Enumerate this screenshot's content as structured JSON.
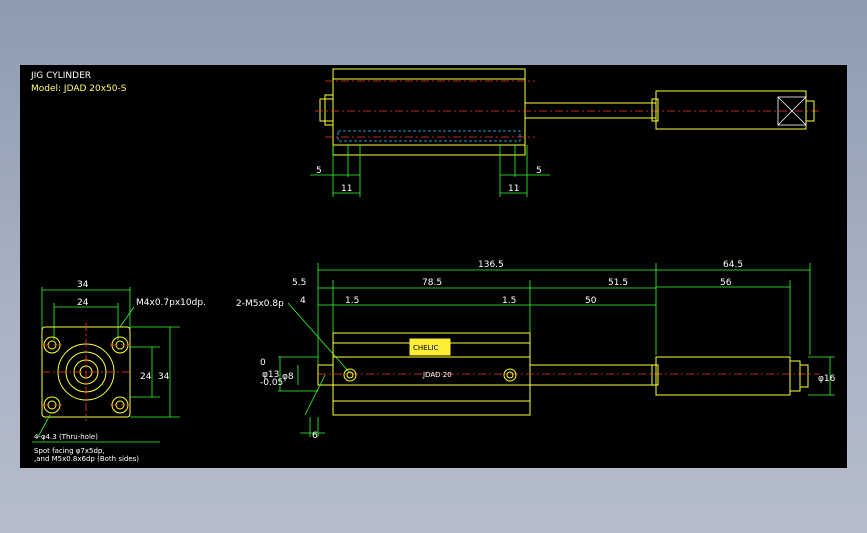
{
  "title": {
    "line1": "JIG CYLINDER",
    "line2": "Model: JDAD 20x50-S"
  },
  "top_view": {
    "dims": {
      "left_offset": "5",
      "left_width": "11",
      "right_width": "11",
      "right_offset": "5"
    }
  },
  "end_view": {
    "dims": {
      "width_outer": "34",
      "width_inner": "24",
      "height_inner": "24",
      "height_outer": "34",
      "thread": "M4x0.7px10dp."
    },
    "notes": {
      "holes": "4-φ4.3 (Thru-hole)",
      "spot1": "Spot facing φ7x5dp,",
      "spot2": ",and M5x0.8x6dp (Both sides)"
    }
  },
  "side_view": {
    "dims": {
      "total_body": "136.5",
      "rod_ext": "64.5",
      "d5_5": "5.5",
      "d78_5": "78.5",
      "d51_5": "51.5",
      "d4": "4",
      "d1_5a": "1.5",
      "d1_5b": "1.5",
      "d50": "50",
      "d56": "56",
      "tol": "0\n-0.05",
      "tol_top": "0",
      "tol_bot": "-0.05",
      "phi13": "φ13",
      "phi8": "φ8",
      "phi16": "φ16",
      "d6": "6",
      "port": "2-M5x0.8p",
      "label": "CHELIC",
      "sublabel": "JDAD 20"
    }
  }
}
